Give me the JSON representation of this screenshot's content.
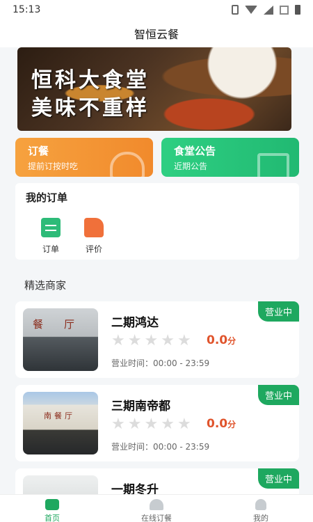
{
  "status": {
    "time": "15:13"
  },
  "header": {
    "title": "智恒云餐"
  },
  "banner": {
    "line1": "恒科大食堂",
    "line2": "美味不重样"
  },
  "actions": [
    {
      "title": "订餐",
      "subtitle": "提前订按时吃",
      "color": "#f28d2e"
    },
    {
      "title": "食堂公告",
      "subtitle": "近期公告",
      "color": "#22bb74"
    }
  ],
  "orders": {
    "title": "我的订单",
    "items": [
      {
        "label": "订单",
        "icon": "clipboard-icon"
      },
      {
        "label": "评价",
        "icon": "thumbs-up-icon"
      }
    ]
  },
  "featured_title": "精选商家",
  "shops": [
    {
      "name": "二期鸿达",
      "score": "0.0",
      "score_unit": "分",
      "rating_stars": 0,
      "hours": "营业时间：00:00 - 23:59",
      "badge": "营业中",
      "sign": "餐厅"
    },
    {
      "name": "三期南帝都",
      "score": "0.0",
      "score_unit": "分",
      "rating_stars": 0,
      "hours": "营业时间：00:00 - 23:59",
      "badge": "营业中",
      "sign": "南餐厅"
    },
    {
      "name": "一期冬升",
      "badge": "营业中"
    }
  ],
  "tabs": [
    {
      "label": "首页",
      "active": true
    },
    {
      "label": "在线订餐",
      "active": false
    },
    {
      "label": "我的",
      "active": false
    }
  ],
  "colors": {
    "accent": "#1ea85f",
    "score": "#e0542c"
  }
}
